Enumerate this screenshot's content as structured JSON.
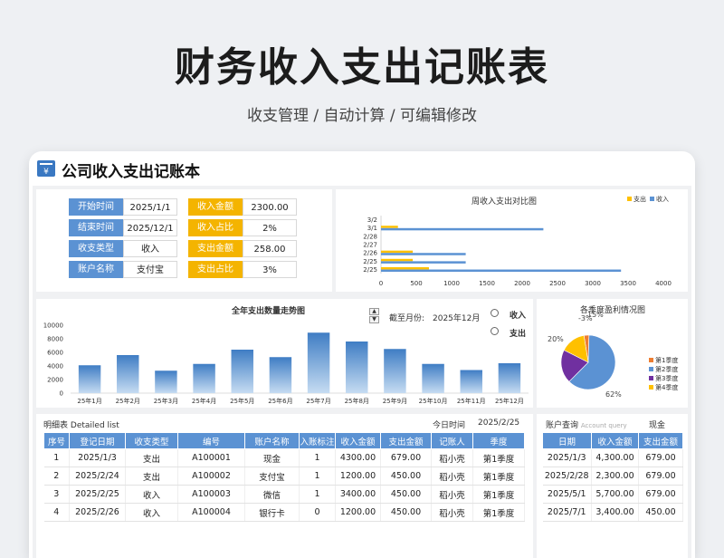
{
  "hero": {
    "title": "财务收入支出记账表",
    "subtitle": "收支管理 / 自动计算 / 可编辑修改"
  },
  "app": {
    "title": "公司收入支出记账本",
    "icon": "yen-ledger-icon"
  },
  "summary": {
    "left": [
      {
        "label": "开始时间",
        "value": "2025/1/1"
      },
      {
        "label": "结束时间",
        "value": "2025/12/1"
      },
      {
        "label": "收支类型",
        "value": "收入"
      },
      {
        "label": "账户名称",
        "value": "支付宝"
      }
    ],
    "right": [
      {
        "label": "收入金额",
        "value": "2300.00"
      },
      {
        "label": "收入占比",
        "value": "2%"
      },
      {
        "label": "支出金额",
        "value": "258.00"
      },
      {
        "label": "支出占比",
        "value": "3%"
      }
    ]
  },
  "colors": {
    "blue": "#5b92d3",
    "gold": "#f4b400",
    "orange": "#ed7d31",
    "purple": "#7030a0",
    "yellow": "#ffc000",
    "bar_blue": "#4a86c8"
  },
  "trend_controls": {
    "label": "截至月份:",
    "month": "2025年12月",
    "options": [
      "收入",
      "支出"
    ]
  },
  "chart_data": [
    {
      "type": "bar",
      "title": "周收入支出对比图",
      "orientation": "horizontal",
      "categories": [
        "2/25",
        "2/25",
        "2/26",
        "2/27",
        "2/28",
        "3/1",
        "3/2"
      ],
      "series": [
        {
          "name": "支出",
          "color": "#ffc000",
          "values": [
            679,
            450,
            450,
            0,
            0,
            240,
            0
          ]
        },
        {
          "name": "收入",
          "color": "#5b92d3",
          "values": [
            3400,
            1200,
            1200,
            0,
            0,
            2300,
            0
          ]
        }
      ],
      "xlim": [
        0,
        4000
      ],
      "xticks": [
        "0",
        "500",
        "1000",
        "1500",
        "2000",
        "2500",
        "3000",
        "3500",
        "4000"
      ],
      "legend": "top-right"
    },
    {
      "type": "bar",
      "title": "全年支出数量走势图",
      "categories": [
        "25年1月",
        "25年2月",
        "25年3月",
        "25年4月",
        "25年5月",
        "25年6月",
        "25年7月",
        "25年8月",
        "25年9月",
        "25年10月",
        "25年11月",
        "25年12月"
      ],
      "values": [
        4100,
        5600,
        3300,
        4300,
        6400,
        5300,
        8900,
        7600,
        6500,
        4300,
        3400,
        4400
      ],
      "ylim": [
        0,
        10000
      ],
      "yticks": [
        "0",
        "2000",
        "4000",
        "6000",
        "8000",
        "10000"
      ]
    },
    {
      "type": "pie",
      "title": "各季度盈利情况图",
      "slices": [
        {
          "name": "第1季度",
          "value": 3,
          "label": "-3%",
          "color": "#ed7d31"
        },
        {
          "name": "第2季度",
          "value": 62,
          "label": "62%",
          "color": "#5b92d3"
        },
        {
          "name": "第3季度",
          "value": 20,
          "label": "20%",
          "color": "#7030a0"
        },
        {
          "name": "第4季度",
          "value": 15,
          "label": "15%",
          "color": "#ffc000"
        }
      ],
      "legend": "right"
    }
  ],
  "detail": {
    "title": "明细表",
    "title_en": "Detailed list",
    "date_label": "今日时间",
    "date": "2025/2/25",
    "columns": [
      "序号",
      "登记日期",
      "收支类型",
      "编号",
      "账户名称",
      "入账标注",
      "收入金额",
      "支出金额",
      "记账人",
      "季度"
    ],
    "rows": [
      [
        "1",
        "2025/1/3",
        "支出",
        "A100001",
        "现金",
        "1",
        "4300.00",
        "679.00",
        "稻小壳",
        "第1季度"
      ],
      [
        "2",
        "2025/2/24",
        "支出",
        "A100002",
        "支付宝",
        "1",
        "1200.00",
        "450.00",
        "稻小壳",
        "第1季度"
      ],
      [
        "3",
        "2025/2/25",
        "收入",
        "A100003",
        "微信",
        "1",
        "3400.00",
        "450.00",
        "稻小壳",
        "第1季度"
      ],
      [
        "4",
        "2025/2/26",
        "收入",
        "A100004",
        "银行卡",
        "0",
        "1200.00",
        "450.00",
        "稻小壳",
        "第1季度"
      ]
    ]
  },
  "account": {
    "title": "账户查询",
    "title_en": "Account query",
    "account": "现金",
    "columns": [
      "日期",
      "收入金额",
      "支出金额"
    ],
    "rows": [
      [
        "2025/1/3",
        "4,300.00",
        "679.00"
      ],
      [
        "2025/2/28",
        "2,300.00",
        "679.00"
      ],
      [
        "2025/5/1",
        "5,700.00",
        "679.00"
      ],
      [
        "2025/7/1",
        "3,400.00",
        "450.00"
      ]
    ]
  }
}
